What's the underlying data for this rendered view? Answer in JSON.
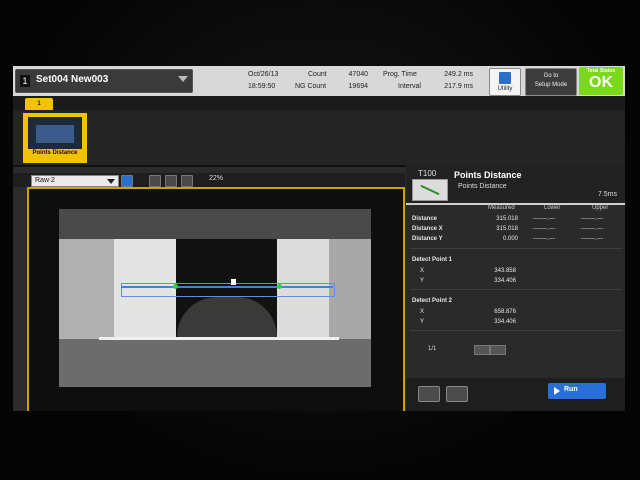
{
  "scene": {
    "number": "1",
    "name": "Set004  New003"
  },
  "header": {
    "date": "Oct/26/13",
    "time": "18:59:50",
    "count_label": "Count",
    "count_value": "47040",
    "ng_label": "NG Count",
    "ng_value": "19694",
    "prog_label": "Prog. Time",
    "prog_value": "249.2 ms",
    "interval_label": "Interval",
    "interval_value": "217.9 ms",
    "utility_label": "Utility",
    "setup_label_1": "Go to",
    "setup_label_2": "Setup Mode",
    "status_title": "Total Status",
    "status_value": "OK",
    "status_color": "#7bd81a"
  },
  "page_tab": "1",
  "thumbnail": {
    "label": "Points Distance"
  },
  "image_toolbar": {
    "view": "Raw 2",
    "zoom": "22%",
    "icons": [
      "image-mode-icon",
      "zoom-in-icon",
      "zoom-out-icon",
      "fit-icon"
    ]
  },
  "tool": {
    "id": "T100",
    "title": "Points Distance",
    "subtitle": "Points Distance",
    "time": "7.5ms",
    "columns": {
      "measured": "Measured",
      "lower": "Lower",
      "upper": "Upper"
    },
    "rows": [
      {
        "name": "Distance",
        "measured": "315.018",
        "lower": "-------.---",
        "upper": "-------.---"
      },
      {
        "name": "Distance X",
        "measured": "315.018",
        "lower": "-------.---",
        "upper": "-------.---"
      },
      {
        "name": "Distance Y",
        "measured": "0.000",
        "lower": "-------.---",
        "upper": "-------.---"
      }
    ],
    "points": [
      {
        "title": "Detect Point 1",
        "x_label": "X",
        "x": "343.858",
        "y_label": "Y",
        "y": "334.406"
      },
      {
        "title": "Detect Point 2",
        "x_label": "X",
        "x": "658.876",
        "y_label": "Y",
        "y": "334.406"
      }
    ],
    "page": "1/1"
  },
  "run": {
    "label": "Run"
  },
  "accent": "#f2c300"
}
